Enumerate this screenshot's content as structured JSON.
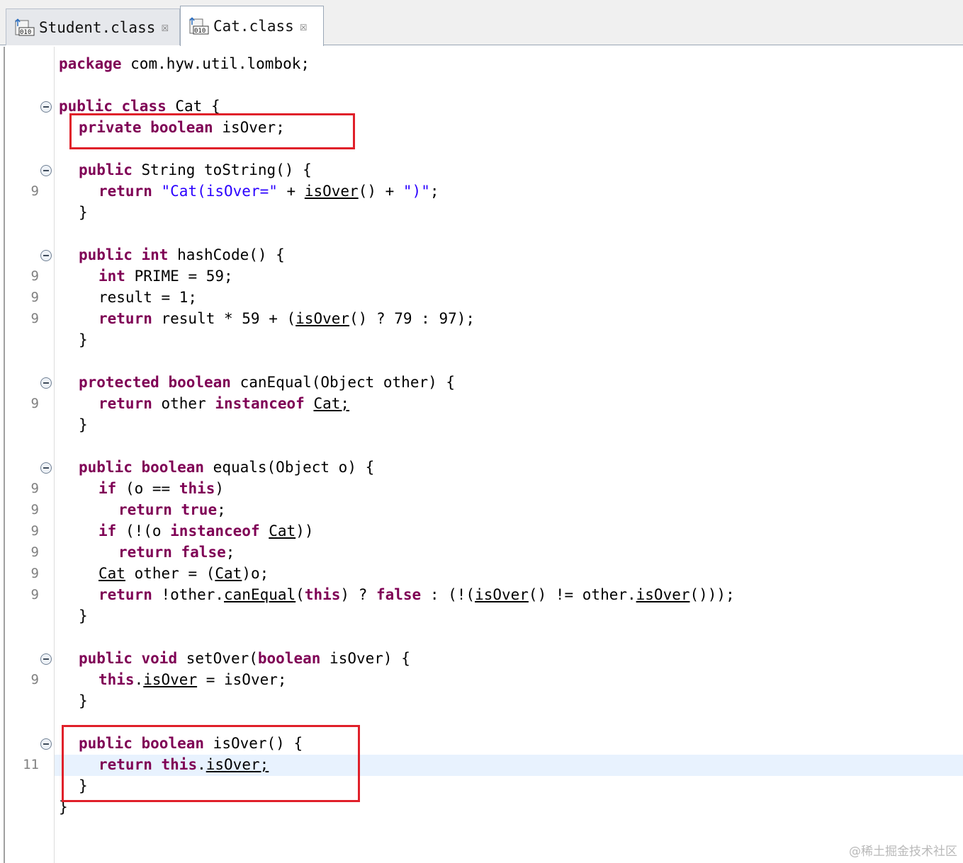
{
  "tabs": [
    {
      "label": "Student.class",
      "icon": "class-file-icon",
      "active": false
    },
    {
      "label": "Cat.class",
      "icon": "class-file-icon",
      "active": true
    }
  ],
  "editor": {
    "line_numbers": [
      "9",
      "9",
      "9",
      "9",
      "9",
      "9",
      "9",
      "9",
      "9",
      "9",
      "9",
      "9",
      "9",
      "11"
    ],
    "code": {
      "package_kw": "package",
      "package_name": " com.hyw.util.lombok;",
      "class_public": "public",
      "class_class": "class",
      "class_name": " Cat {",
      "field_private": "private",
      "field_boolean": "boolean",
      "field_name": " isOver;",
      "tostring_public": "public",
      "tostring_sig": " String toString() {",
      "tostring_return": "return",
      "tostring_str1": "\"Cat(isOver=\"",
      "tostring_plus1": " + ",
      "tostring_call": "isOver",
      "tostring_rest1": "() + ",
      "tostring_str2": "\")\"",
      "tostring_semi": ";",
      "close_brace": "}",
      "hash_public": "public",
      "hash_int": "int",
      "hash_sig": " hashCode() {",
      "prime_int": "int",
      "prime_rest": " PRIME = 59;",
      "result_line": "result = 1;",
      "hash_return": "return",
      "hash_rest1": " result * 59 + (",
      "hash_call": "isOver",
      "hash_rest2": "() ? 79 : 97);",
      "canequal_protected": "protected",
      "canequal_boolean": "boolean",
      "canequal_sig": " canEqual(Object other) {",
      "canequal_return": "return",
      "canequal_other": " other ",
      "canequal_instanceof": "instanceof",
      "canequal_cat": "Cat",
      "semi": ";",
      "equals_public": "public",
      "equals_boolean": "boolean",
      "equals_sig": " equals(Object o) {",
      "if1_if": "if",
      "if1_rest": " (o == ",
      "if1_this": "this",
      "if1_close": ")",
      "ret_true_return": "return",
      "ret_true_true": "true",
      "if2_if": "if",
      "if2_rest": " (!(o ",
      "if2_instanceof": "instanceof",
      "if2_cat": "Cat",
      "if2_close": "))",
      "ret_false_return": "return",
      "ret_false_false": "false",
      "cast_cat1": "Cat",
      "cast_mid": " other = (",
      "cast_cat2": "Cat",
      "cast_end": ")o;",
      "eqret_return": "return",
      "eqret_a": " !other.",
      "eqret_canequal": "canEqual",
      "eqret_b": "(",
      "eqret_this": "this",
      "eqret_c": ") ? ",
      "eqret_false": "false",
      "eqret_d": " : (!(",
      "eqret_isover1": "isOver",
      "eqret_e": "() != other.",
      "eqret_isover2": "isOver",
      "eqret_f": "()));",
      "set_public": "public",
      "set_void": "void",
      "set_name": " setOver(",
      "set_boolean": "boolean",
      "set_rest": " isOver) {",
      "set_this": "this",
      "set_dot": ".",
      "set_field": "isOver",
      "set_assign": " = isOver;",
      "get_public": "public",
      "get_boolean": "boolean",
      "get_sig": " isOver() {",
      "get_return": "return",
      "get_this": "this",
      "get_dot": ".",
      "get_field": "isOver;"
    }
  },
  "watermark": "@稀土掘金技术社区",
  "colors": {
    "keyword": "#7f0055",
    "string": "#2a00ff",
    "highlight_box": "#e0202a",
    "current_line": "#e8f2fe"
  }
}
